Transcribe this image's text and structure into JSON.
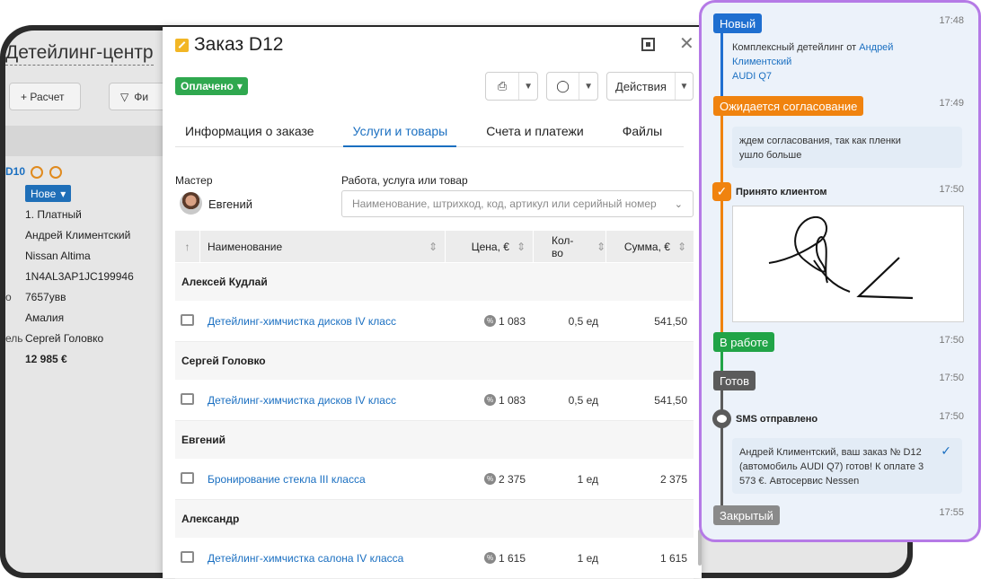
{
  "background": {
    "title": "Детейлинг-центр",
    "calc_button": "+ Расчет",
    "filter_button": "Фи",
    "order_id": "D10",
    "status": "Нове",
    "rows": [
      "1. Платный",
      "Андрей Климентский",
      "Nissan Altima",
      "1N4AL3AP1JC199946",
      "7657увв",
      "Амалия",
      "Сергей Головко",
      "12 985 €"
    ],
    "row_labels": [
      "о",
      "ель"
    ]
  },
  "modal": {
    "title": "Заказ D12",
    "paid_label": "Оплачено",
    "actions_label": "Действия",
    "tabs": [
      {
        "label": "Информация о заказе",
        "active": false
      },
      {
        "label": "Услуги и товары",
        "active": true
      },
      {
        "label": "Счета и платежи",
        "active": false
      },
      {
        "label": "Файлы",
        "active": false
      }
    ],
    "master_label": "Мастер",
    "master_name": "Евгений",
    "search_label": "Работа, услуга или товар",
    "search_placeholder": "Наименование, штрихкод, код, артикул или серийный номер",
    "columns": {
      "name": "Наименование",
      "price": "Цена, €",
      "qty": "Кол-во",
      "sum": "Сумма, €"
    },
    "groups": [
      {
        "master": "Алексей Кудлай",
        "item": {
          "name": "Детейлинг-химчистка дисков IV класс",
          "price": "1 083",
          "qty": "0,5 ед",
          "sum": "541,50"
        }
      },
      {
        "master": "Сергей Головко",
        "item": {
          "name": "Детейлинг-химчистка дисков IV класс",
          "price": "1 083",
          "qty": "0,5 ед",
          "sum": "541,50"
        }
      },
      {
        "master": "Евгений",
        "item": {
          "name": "Бронирование стекла III класса",
          "price": "2 375",
          "qty": "1 ед",
          "sum": "2 375"
        }
      },
      {
        "master": "Александр",
        "item": {
          "name": "Детейлинг-химчистка салона IV класса",
          "price": "1 615",
          "qty": "1 ед",
          "sum": "1 615"
        }
      }
    ]
  },
  "timeline": {
    "events": [
      {
        "badge": "Новый",
        "color": "#1f6fd0",
        "time": "17:48"
      },
      {
        "badge": "Ожидается согласование",
        "color": "#f0830f",
        "time": "17:49"
      },
      {
        "title": "Принято клиентом",
        "time": "17:50"
      },
      {
        "badge": "В работе",
        "color": "#21a447",
        "time": "17:50"
      },
      {
        "badge": "Готов",
        "color": "#5b5b5b",
        "time": "17:50"
      },
      {
        "title": "SMS отправлено",
        "time": "17:50"
      },
      {
        "badge": "Закрытый",
        "color": "#8a8a8a",
        "time": "17:55"
      }
    ],
    "new_text_prefix": "Комплексный детейлинг от",
    "new_text_link1": "Андрей",
    "new_text_link2": "Климентский",
    "new_text_link3": "AUDI Q7",
    "waiting_comment_1": "ждем согласования, так как пленки",
    "waiting_comment_2": "ушло больше",
    "sms_text_1": "Андрей Климентский, ваш заказ № D12",
    "sms_text_2": "(автомобиль AUDI Q7) готов! К оплате 3",
    "sms_text_3": "573 €. Автосервис Nessen"
  }
}
